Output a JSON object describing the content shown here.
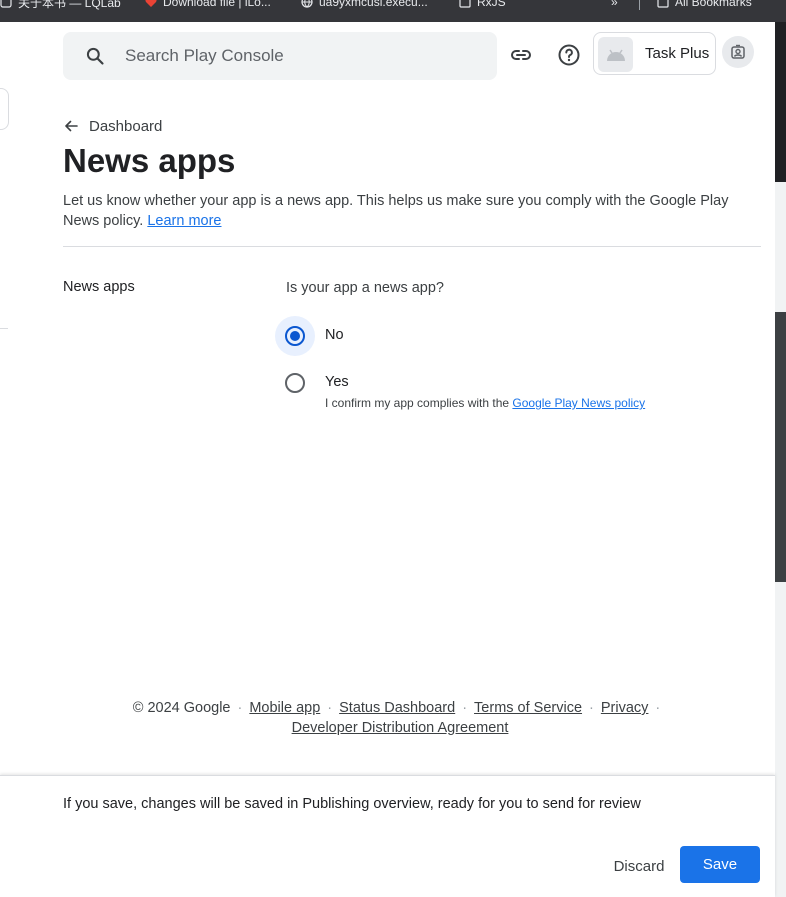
{
  "browser": {
    "bookmarks": [
      {
        "label": "关于本书 — LQLab",
        "icon": "page-icon"
      },
      {
        "label": "Download file | iLo...",
        "icon": "heart-icon"
      },
      {
        "label": "ua9yxmcusi.execu...",
        "icon": "globe-icon"
      },
      {
        "label": "RxJS",
        "icon": "folder-icon"
      }
    ],
    "overflow": "»",
    "all_bookmarks": "All Bookmarks"
  },
  "header": {
    "search_placeholder": "Search Play Console",
    "app_name": "Task Plus",
    "link_icon": "link-icon",
    "help_icon": "help-icon",
    "profile_icon": "account-switch-icon"
  },
  "breadcrumb": {
    "back_label": "Dashboard"
  },
  "page": {
    "title": "News apps",
    "intro": "Let us know whether your app is a news app. This helps us make sure you comply with the Google Play News policy.",
    "learn_more": "Learn more"
  },
  "form": {
    "section_label": "News apps",
    "question": "Is your app a news app?",
    "options": [
      {
        "label": "No",
        "selected": true
      },
      {
        "label": "Yes",
        "selected": false,
        "sub_prefix": "I confirm my app complies with the",
        "sub_link": "Google Play News policy"
      }
    ]
  },
  "footer": {
    "copyright": "© 2024 Google",
    "links": [
      "Mobile app",
      "Status Dashboard",
      "Terms of Service",
      "Privacy",
      "Developer Distribution Agreement"
    ]
  },
  "savebar": {
    "message": "If you save, changes will be saved in Publishing overview, ready for you to send for review",
    "discard": "Discard",
    "save": "Save"
  },
  "colors": {
    "accent": "#1a73e8",
    "radio": "#0b57d0",
    "radio_halo": "#e8f0fe"
  }
}
